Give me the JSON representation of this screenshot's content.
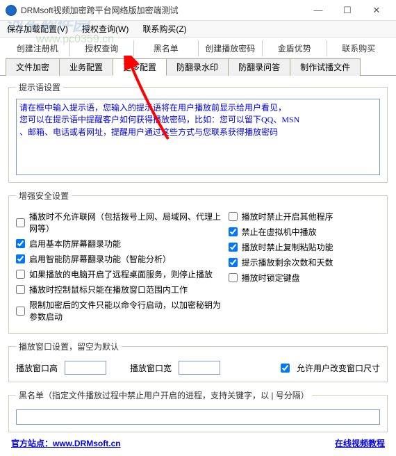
{
  "window": {
    "title": "DRMsoft视频加密跨平台网络版加密端测试",
    "min": "—",
    "max": "☐",
    "close": "✕"
  },
  "menubar": {
    "m1": "保存加载配置(V)",
    "m2": "授权查询(W)",
    "m3": "联系购买(Z)"
  },
  "toolbar1": {
    "b1": "创建注册机",
    "b2": "授权查询",
    "b3": "黑名单",
    "b4": "创建播放密码",
    "b5": "金盾优势",
    "b6": "联系购买"
  },
  "tabs": {
    "t1": "文件加密",
    "t2": "业务配置",
    "t3": "更多配置",
    "t4": "防翻录水印",
    "t5": "防翻录问答",
    "t6": "制作试播文件"
  },
  "hint": {
    "legend": "提示语设置",
    "text": "请在框中输入提示语，您输入的提示语将在用户播放前显示给用户看见，\n您可以在提示语中提醒客户如何获得播放密码，比如：您可以留下QQ、MSN\n、邮箱、电话或者网址，提醒用户通过这些方式与您联系获得播放密码"
  },
  "security": {
    "legend": "增强安全设置",
    "c1": "播放时不允许联网（包括拨号上网、局域网、代理上网等）",
    "c2": "启用基本防屏幕翻录功能",
    "c3": "启用智能防屏幕翻录功能（智能分析）",
    "c4": "如果播放的电脑开启了远程桌面服务，则停止播放",
    "c5": "播放时控制鼠标只能在播放窗口范围内工作",
    "c6": "限制加密后的文件只能以命令行启动，以加密秘钥为参数启动",
    "r1": "播放时禁止开启其他程序",
    "r2": "禁止在虚拟机中播放",
    "r3": "播放时禁止复制粘贴功能",
    "r4": "提示播放剩余次数和天数",
    "r5": "播放时锁定键盘"
  },
  "winsize": {
    "legend": "播放窗口设置，留空为默认",
    "h_label": "播放窗口高",
    "w_label": "播放窗口宽",
    "allow": "允许用户改变窗口尺寸",
    "h_val": "",
    "w_val": ""
  },
  "blacklist": {
    "legend": "黑名单（指定文件播放过程中禁止用户开启的进程，支持关键字，以 | 号分隔）",
    "val": ""
  },
  "footer": {
    "site_label": "官方站点：",
    "site_url": "www.DRMsoft.cn",
    "tutorial": "在线视频教程"
  },
  "watermark": {
    "w1": "河东软件园",
    "w2": "www.pc0359.cn"
  }
}
